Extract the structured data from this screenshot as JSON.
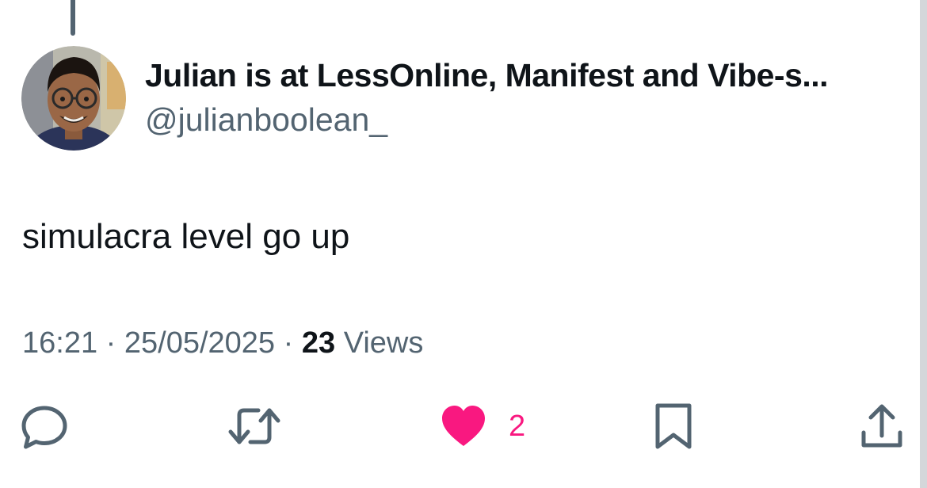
{
  "author": {
    "display_name": "Julian is at LessOnline, Manifest and Vibe-s...",
    "handle": "@julianboolean_"
  },
  "tweet": {
    "text": "simulacra level go up"
  },
  "meta": {
    "time": "16:21",
    "separator": "·",
    "date": "25/05/2025",
    "views_count": "23",
    "views_label": "Views"
  },
  "actions": {
    "reply_icon": "speech-bubble-icon",
    "retweet_icon": "retweet-arrows-icon",
    "like_icon": "heart-icon",
    "like_count": "2",
    "bookmark_icon": "bookmark-icon",
    "share_icon": "share-upload-icon"
  },
  "colors": {
    "text_primary": "#0f1419",
    "text_secondary": "#536471",
    "like_pink": "#f91880",
    "icon_gray": "#536471"
  }
}
